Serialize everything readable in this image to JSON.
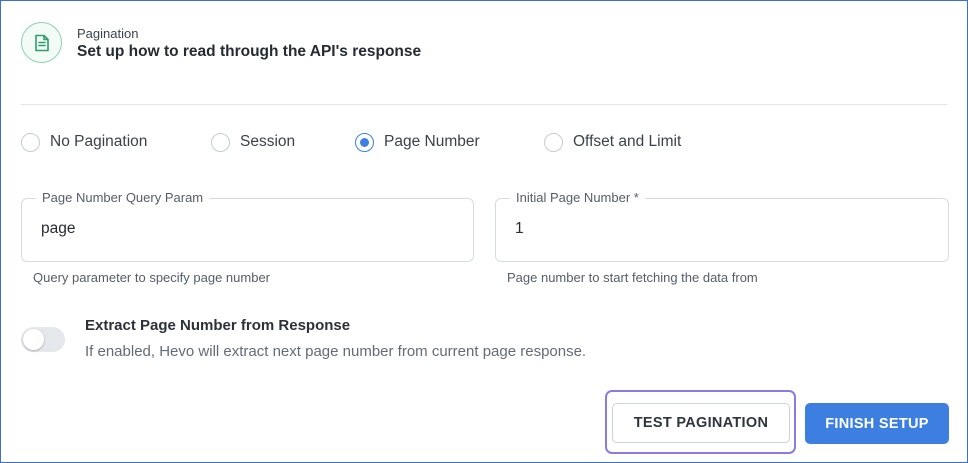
{
  "header": {
    "icon": "document-icon",
    "small_label": "Pagination",
    "title": "Set up how to read through the API's response"
  },
  "pagination_options": {
    "selected": "Page Number",
    "items": [
      {
        "label": "No Pagination",
        "checked": false
      },
      {
        "label": "Session",
        "checked": false
      },
      {
        "label": "Page Number",
        "checked": true
      },
      {
        "label": "Offset and Limit",
        "checked": false
      }
    ]
  },
  "fields": {
    "page_param": {
      "label": "Page Number Query Param",
      "value": "page",
      "help": "Query parameter to specify page number"
    },
    "initial_page": {
      "label": "Initial Page Number *",
      "value": "1",
      "help": "Page number to start fetching the data from"
    }
  },
  "extract_toggle": {
    "title": "Extract Page Number from Response",
    "description": "If enabled, Hevo will extract next page number from current page response.",
    "enabled": false
  },
  "actions": {
    "test_label": "TEST PAGINATION",
    "finish_label": "FINISH SETUP"
  },
  "colors": {
    "accent": "#3d7fe0",
    "focus_ring": "#8b79e6",
    "icon_ring": "#8fd0b0",
    "frame_border": "#3b6fd4"
  }
}
